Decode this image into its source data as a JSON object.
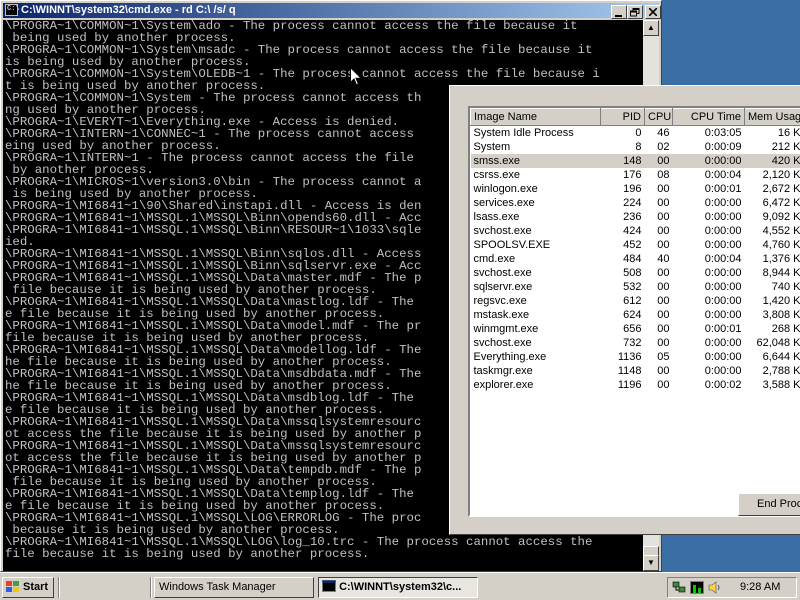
{
  "cmd_window": {
    "title": "C:\\WINNT\\system32\\cmd.exe - rd C:\\ /s/ q",
    "console_lines": [
      "\\PROGRA~1\\COMMON~1\\System\\ado - The process cannot access the file because it",
      " being used by another process.",
      "\\PROGRA~1\\COMMON~1\\System\\msadc - The process cannot access the file because it",
      "is being used by another process.",
      "\\PROGRA~1\\COMMON~1\\System\\OLEDB~1 - The process cannot access the file because i",
      "t is being used by another process.",
      "\\PROGRA~1\\COMMON~1\\System - The process cannot access th",
      "ng used by another process.",
      "\\PROGRA~1\\EVERYT~1\\Everything.exe - Access is denied.",
      "\\PROGRA~1\\INTERN~1\\CONNEC~1 - The process cannot access",
      "eing used by another process.",
      "\\PROGRA~1\\INTERN~1 - The process cannot access the file",
      " by another process.",
      "\\PROGRA~1\\MICROS~1\\version3.0\\bin - The process cannot a",
      " is being used by another process.",
      "\\PROGRA~1\\MI6841~1\\90\\Shared\\instapi.dll - Access is den",
      "\\PROGRA~1\\MI6841~1\\MSSQL.1\\MSSQL\\Binn\\opends60.dll - Acc",
      "\\PROGRA~1\\MI6841~1\\MSSQL.1\\MSSQL\\Binn\\RESOUR~1\\1033\\sqle",
      "ied.",
      "\\PROGRA~1\\MI6841~1\\MSSQL.1\\MSSQL\\Binn\\sqlos.dll - Access",
      "\\PROGRA~1\\MI6841~1\\MSSQL.1\\MSSQL\\Binn\\sqlservr.exe - Acc",
      "\\PROGRA~1\\MI6841~1\\MSSQL.1\\MSSQL\\Data\\master.mdf - The p",
      " file because it is being used by another process.",
      "\\PROGRA~1\\MI6841~1\\MSSQL.1\\MSSQL\\Data\\mastlog.ldf - The",
      "e file because it is being used by another process.",
      "\\PROGRA~1\\MI6841~1\\MSSQL.1\\MSSQL\\Data\\model.mdf - The pr",
      "file because it is being used by another process.",
      "\\PROGRA~1\\MI6841~1\\MSSQL.1\\MSSQL\\Data\\modellog.ldf - The",
      "he file because it is being used by another process.",
      "\\PROGRA~1\\MI6841~1\\MSSQL.1\\MSSQL\\Data\\msdbdata.mdf - The",
      "he file because it is being used by another process.",
      "\\PROGRA~1\\MI6841~1\\MSSQL.1\\MSSQL\\Data\\msdblog.ldf - The",
      "e file because it is being used by another process.",
      "\\PROGRA~1\\MI6841~1\\MSSQL.1\\MSSQL\\Data\\mssqlsystemresourc",
      "ot access the file because it is being used by another p",
      "\\PROGRA~1\\MI6841~1\\MSSQL.1\\MSSQL\\Data\\mssqlsystemresourc",
      "ot access the file because it is being used by another p",
      "\\PROGRA~1\\MI6841~1\\MSSQL.1\\MSSQL\\Data\\tempdb.mdf - The p",
      " file because it is being used by another process.",
      "\\PROGRA~1\\MI6841~1\\MSSQL.1\\MSSQL\\Data\\templog.ldf - The",
      "e file because it is being used by another process.",
      "\\PROGRA~1\\MI6841~1\\MSSQL.1\\MSSQL\\LOG\\ERRORLOG - The proc",
      " because it is being used by another process.",
      "\\PROGRA~1\\MI6841~1\\MSSQL.1\\MSSQL\\LOG\\log_10.trc - The process cannot access the",
      "file because it is being used by another process."
    ]
  },
  "task_manager": {
    "columns": [
      "Image Name",
      "PID",
      "CPU",
      "CPU Time",
      "Mem Usage"
    ],
    "rows": [
      [
        "System Idle Process",
        "0",
        "46",
        "0:03:05",
        "16 K"
      ],
      [
        "System",
        "8",
        "02",
        "0:00:09",
        "212 K"
      ],
      [
        "smss.exe",
        "148",
        "00",
        "0:00:00",
        "420 K"
      ],
      [
        "csrss.exe",
        "176",
        "08",
        "0:00:04",
        "2,120 K"
      ],
      [
        "winlogon.exe",
        "196",
        "00",
        "0:00:01",
        "2,672 K"
      ],
      [
        "services.exe",
        "224",
        "00",
        "0:00:00",
        "6,472 K"
      ],
      [
        "lsass.exe",
        "236",
        "00",
        "0:00:00",
        "9,092 K"
      ],
      [
        "svchost.exe",
        "424",
        "00",
        "0:00:00",
        "4,552 K"
      ],
      [
        "SPOOLSV.EXE",
        "452",
        "00",
        "0:00:00",
        "4,760 K"
      ],
      [
        "cmd.exe",
        "484",
        "40",
        "0:00:04",
        "1,376 K"
      ],
      [
        "svchost.exe",
        "508",
        "00",
        "0:00:00",
        "8,944 K"
      ],
      [
        "sqlservr.exe",
        "532",
        "00",
        "0:00:00",
        "740 K"
      ],
      [
        "regsvc.exe",
        "612",
        "00",
        "0:00:00",
        "1,420 K"
      ],
      [
        "mstask.exe",
        "624",
        "00",
        "0:00:00",
        "3,808 K"
      ],
      [
        "winmgmt.exe",
        "656",
        "00",
        "0:00:01",
        "268 K"
      ],
      [
        "svchost.exe",
        "732",
        "00",
        "0:00:00",
        "62,048 K"
      ],
      [
        "Everything.exe",
        "1136",
        "05",
        "0:00:00",
        "6,644 K"
      ],
      [
        "taskmgr.exe",
        "1148",
        "00",
        "0:00:00",
        "2,788 K"
      ],
      [
        "explorer.exe",
        "1196",
        "00",
        "0:00:02",
        "3,588 K"
      ]
    ],
    "selected_row": 2,
    "end_process_label": "End Proc"
  },
  "taskbar": {
    "start_label": "Start",
    "buttons": [
      "Windows Task Manager",
      "C:\\WINNT\\system32\\c..."
    ],
    "active_button": 1,
    "clock": "9:28 AM"
  },
  "colors": {
    "titlebar_start": "#0a246a",
    "titlebar_end": "#a6caf0",
    "console_bg": "#000000",
    "console_fg": "#c0c0c0",
    "face": "#d4d0c8"
  },
  "icons": [
    "cmd-window-icon",
    "minimize-icon",
    "maximize-icon",
    "close-icon",
    "scroll-up-icon",
    "scroll-down-icon",
    "windows-flag-icon",
    "network-tray-icon",
    "task-manager-tray-icon",
    "volume-tray-icon",
    "mouse-cursor-icon"
  ]
}
